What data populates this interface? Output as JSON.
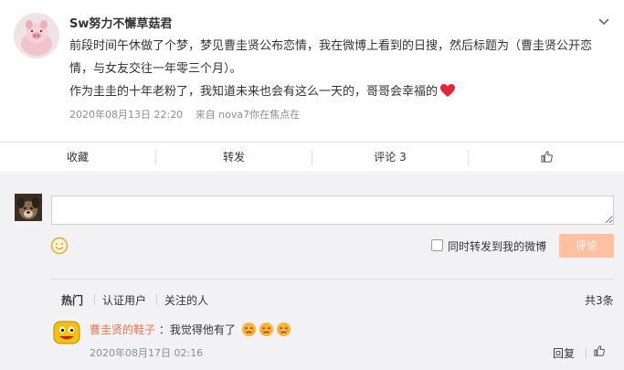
{
  "post": {
    "username": "Sw努力不懈草菇君",
    "paragraph1": "前段时间午休做了个梦，梦见曹圭贤公布恋情，我在微博上看到的日搜，然后标题为（曹圭贤公开恋情，与女友交往一年零三个月）。",
    "paragraph2": "作为圭圭的十年老粉了，我知道未来也会有这么一天的，哥哥会幸福的",
    "date": "2020年08月13日 22:20",
    "source": "来自 nova7你在焦点在"
  },
  "actions": {
    "collect": "收藏",
    "forward": "转发",
    "comment": "评论 3",
    "like": ""
  },
  "comment_box": {
    "input_value": "",
    "forward_label": "同时转发到我的微博",
    "submit": "评论"
  },
  "tabs": {
    "hot": "热门",
    "verified": "认证用户",
    "following": "关注的人",
    "count": "共3条"
  },
  "comment": {
    "user": "曹圭贤的鞋子",
    "text": "：我觉得他有了",
    "time": "2020年08月17日 02:16",
    "reply": "回复"
  },
  "colors": {
    "accent": "#eb7350",
    "submit_bg": "#ffc09f",
    "comment_area_bg": "#f2f2f5",
    "heart": "#e5233d"
  },
  "icons": [
    "chevron-down-icon",
    "heart-icon",
    "thumbs-up-icon",
    "smiley-icon",
    "sad-face-icon"
  ]
}
